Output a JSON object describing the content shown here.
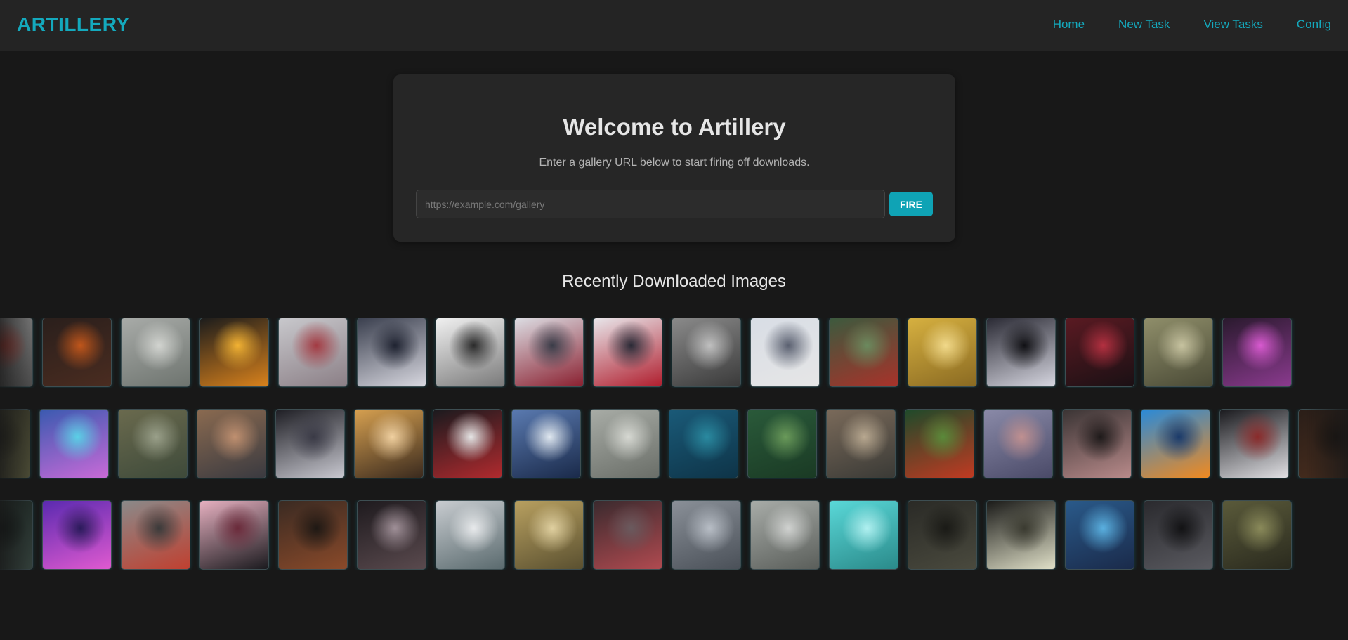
{
  "header": {
    "brand": "ARTILLERY",
    "nav": {
      "home": "Home",
      "new_task": "New Task",
      "view_tasks": "View Tasks",
      "config": "Config"
    }
  },
  "hero": {
    "title": "Welcome to Artillery",
    "subtitle": "Enter a gallery URL below to start firing off downloads.",
    "url_placeholder": "https://example.com/gallery",
    "url_value": "",
    "fire_label": "FIRE"
  },
  "gallery": {
    "title": "Recently Downloaded Images",
    "accent_color": "#14a9bd",
    "rows": [
      {
        "offset": -52,
        "items": [
          {
            "subject": "statue with red sun",
            "colors": [
              "#9a9a9a",
              "#5a5a5a",
              "#c23a2f"
            ]
          },
          {
            "subject": "dark figure with fire",
            "colors": [
              "#2a1f1c",
              "#4a2c20",
              "#c0561b"
            ]
          },
          {
            "subject": "military tank",
            "colors": [
              "#a8aba8",
              "#6e746f",
              "#d2d4d0"
            ]
          },
          {
            "subject": "fire warrior",
            "colors": [
              "#1c1c1c",
              "#d9821c",
              "#f2b233"
            ]
          },
          {
            "subject": "red planet in clouds",
            "colors": [
              "#c8c8cc",
              "#8b7f86",
              "#a33a42"
            ]
          },
          {
            "subject": "white haired warrior",
            "colors": [
              "#3a3f4e",
              "#d8d8e0",
              "#1e2230"
            ]
          },
          {
            "subject": "armored knight mono",
            "colors": [
              "#f0f0f0",
              "#7a7a7a",
              "#2a2a2a"
            ]
          },
          {
            "subject": "red hooded archer",
            "colors": [
              "#dcdde3",
              "#8a2030",
              "#3a3c48"
            ]
          },
          {
            "subject": "red haired warrior",
            "colors": [
              "#e8e6ea",
              "#b01e2e",
              "#2a2a36"
            ]
          },
          {
            "subject": "black cat statue",
            "colors": [
              "#8a8a8a",
              "#3a3a3a",
              "#c0c0c0"
            ]
          },
          {
            "subject": "space shuttle",
            "colors": [
              "#d8dde5",
              "#e6e6e6",
              "#5a6070"
            ]
          },
          {
            "subject": "torii gate forest",
            "colors": [
              "#3c5a3e",
              "#a8322a",
              "#6b8a5e"
            ]
          },
          {
            "subject": "golden temple",
            "colors": [
              "#d6b040",
              "#8a6a22",
              "#f1d98a"
            ]
          },
          {
            "subject": "dark angel",
            "colors": [
              "#2a2a34",
              "#d6d6e0",
              "#101014"
            ]
          },
          {
            "subject": "crimson lady",
            "colors": [
              "#5a1a22",
              "#1a1014",
              "#b33040"
            ]
          },
          {
            "subject": "ruins with sphere",
            "colors": [
              "#8f8e6a",
              "#4a4a36",
              "#c7c3a0"
            ]
          },
          {
            "subject": "purple neon figure",
            "colors": [
              "#2a1a2e",
              "#8a3a8e",
              "#d85ad0"
            ]
          }
        ]
      },
      {
        "offset": -56,
        "items": [
          {
            "subject": "dark ruins",
            "colors": [
              "#3a3a2a",
              "#5a5a3e",
              "#2a2a1e"
            ]
          },
          {
            "subject": "neon anime girl",
            "colors": [
              "#3a5ab0",
              "#c86ad8",
              "#5ad0e6"
            ]
          },
          {
            "subject": "off road vehicle",
            "colors": [
              "#6a6a4e",
              "#3e4a3a",
              "#9aa08a"
            ]
          },
          {
            "subject": "armored woman",
            "colors": [
              "#8a6a50",
              "#3a3a40",
              "#c09070"
            ]
          },
          {
            "subject": "gothic woman",
            "colors": [
              "#1e1e24",
              "#c8c8d0",
              "#3a3a46"
            ]
          },
          {
            "subject": "laughing blonde",
            "colors": [
              "#d6a050",
              "#3a2a1e",
              "#f0d0a0"
            ]
          },
          {
            "subject": "red tree moon",
            "colors": [
              "#1a1a1e",
              "#b02a2e",
              "#e6e6e6"
            ]
          },
          {
            "subject": "sci-fi city snow",
            "colors": [
              "#5a7ab0",
              "#1a2a4a",
              "#e0e8f0"
            ]
          },
          {
            "subject": "foggy ship",
            "colors": [
              "#a8aca6",
              "#6a6e68",
              "#d6d8d2"
            ]
          },
          {
            "subject": "underwater boat",
            "colors": [
              "#1a5a78",
              "#0e3448",
              "#2a8aa0"
            ]
          },
          {
            "subject": "jungle",
            "colors": [
              "#2a5a3a",
              "#1a3a24",
              "#6a9a5a"
            ]
          },
          {
            "subject": "detailed creature",
            "colors": [
              "#7a6a5a",
              "#3a3a36",
              "#b8a890"
            ]
          },
          {
            "subject": "koi fish pond",
            "colors": [
              "#1e4a2a",
              "#c03a22",
              "#5a8a3a"
            ]
          },
          {
            "subject": "shipwreck sunset",
            "colors": [
              "#8a8aa8",
              "#4a4a68",
              "#c09090"
            ]
          },
          {
            "subject": "shark mouth",
            "colors": [
              "#3a3434",
              "#b88a8a",
              "#1e1a1a"
            ]
          },
          {
            "subject": "orange race car",
            "colors": [
              "#2a8ad8",
              "#f08a20",
              "#1a3a6a"
            ]
          },
          {
            "subject": "android woman",
            "colors": [
              "#1a1a1e",
              "#e0e0e4",
              "#8a2a2a"
            ]
          },
          {
            "subject": "dark warm scene",
            "colors": [
              "#2a1e18",
              "#4a2e1e",
              "#1a1410"
            ]
          }
        ]
      },
      {
        "offset": -52,
        "items": [
          {
            "subject": "dark cathedral",
            "colors": [
              "#1e2a26",
              "#3a4a44",
              "#101816"
            ]
          },
          {
            "subject": "neon arcade",
            "colors": [
              "#5a2ab0",
              "#e05ad0",
              "#2a1a5a"
            ]
          },
          {
            "subject": "samurai in rain",
            "colors": [
              "#8a8a8a",
              "#c04030",
              "#3a3a3a"
            ]
          },
          {
            "subject": "dark samurai blossom",
            "colors": [
              "#e6b0c0",
              "#1a1a1e",
              "#6a2a3a"
            ]
          },
          {
            "subject": "burning battlefield",
            "colors": [
              "#3a2a22",
              "#8a4a2a",
              "#1e1814"
            ]
          },
          {
            "subject": "dark queen throne",
            "colors": [
              "#1e1a1e",
              "#5a4a4e",
              "#a09098"
            ]
          },
          {
            "subject": "snowy forest",
            "colors": [
              "#c8ccd0",
              "#5a6a6e",
              "#e8eaec"
            ]
          },
          {
            "subject": "golden machine",
            "colors": [
              "#b8a060",
              "#5a5030",
              "#e0d0a0"
            ]
          },
          {
            "subject": "armored red knight",
            "colors": [
              "#3a2a2e",
              "#b04a50",
              "#6a5a5e"
            ]
          },
          {
            "subject": "foggy castle",
            "colors": [
              "#8a9098",
              "#4a5058",
              "#b8bec6"
            ]
          },
          {
            "subject": "ruined street",
            "colors": [
              "#a8aca8",
              "#5a5e5a",
              "#d0d2d0"
            ]
          },
          {
            "subject": "cyan airship",
            "colors": [
              "#5ad8d8",
              "#2a8a8a",
              "#b0f0f0"
            ]
          },
          {
            "subject": "dark shrine",
            "colors": [
              "#2a2a26",
              "#4a4a3e",
              "#1a1a16"
            ]
          },
          {
            "subject": "glowing cave",
            "colors": [
              "#1a1a18",
              "#e0e0c8",
              "#3a3a30"
            ]
          },
          {
            "subject": "blue crystal beast",
            "colors": [
              "#2a5a8a",
              "#1a2a4a",
              "#5ab0e0"
            ]
          },
          {
            "subject": "dark hooded warrior",
            "colors": [
              "#2a2a2e",
              "#5a5a60",
              "#121214"
            ]
          },
          {
            "subject": "mech in swamp",
            "colors": [
              "#5a5a3a",
              "#2a2a1e",
              "#8a8a5a"
            ]
          }
        ]
      }
    ]
  }
}
